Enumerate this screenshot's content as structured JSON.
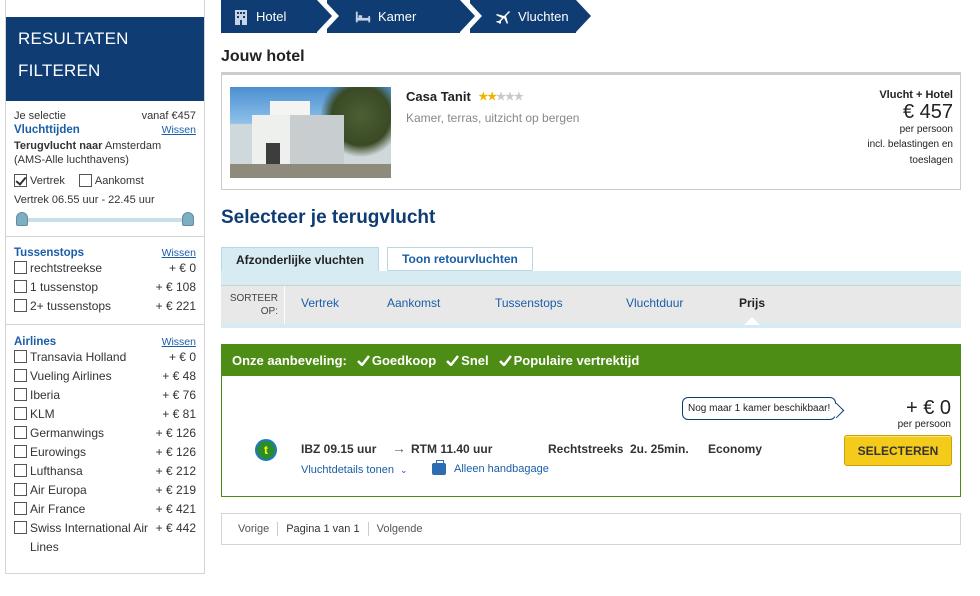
{
  "breadcrumb": {
    "items": [
      {
        "label": "Hotel",
        "icon": "building-icon"
      },
      {
        "label": "Kamer",
        "icon": "bed-icon"
      },
      {
        "label": "Vluchten",
        "icon": "plane-icon"
      }
    ]
  },
  "sidebar": {
    "header_line1": "RESULTATEN",
    "header_line2": "FILTEREN",
    "selection_label": "Je selectie",
    "selection_price": "vanaf €457",
    "flight_times": {
      "title": "Vluchttijden",
      "help": "Wissen",
      "return_prefix": "Terugvlucht naar",
      "return_city": "Amsterdam",
      "airports": "(AMS-Alle luchthavens)",
      "departure_label": "Vertrek",
      "arrival_label": "Aankomst",
      "range_text": "Vertrek 06.55 uur - 22.45 uur"
    },
    "stops": {
      "title": "Tussenstops",
      "help": "Wissen",
      "options": [
        {
          "label": "rechtstreekse",
          "price": "+ € 0"
        },
        {
          "label": "1 tussenstop",
          "price": "+ € 108"
        },
        {
          "label": "2+ tussenstops",
          "price": "+ € 221"
        }
      ]
    },
    "airlines": {
      "title": "Airlines",
      "help": "Wissen",
      "options": [
        {
          "label": "Transavia Holland",
          "price": "+ € 0"
        },
        {
          "label": "Vueling Airlines",
          "price": "+ € 48"
        },
        {
          "label": "Iberia",
          "price": "+ € 76"
        },
        {
          "label": "KLM",
          "price": "+ € 81"
        },
        {
          "label": "Germanwings",
          "price": "+ € 126"
        },
        {
          "label": "Eurowings",
          "price": "+ € 126"
        },
        {
          "label": "Lufthansa",
          "price": "+ € 212"
        },
        {
          "label": "Air Europa",
          "price": "+ € 219"
        },
        {
          "label": "Air France",
          "price": "+ € 421"
        },
        {
          "label": "Swiss International Air Lines",
          "price": "+ € 442"
        }
      ]
    }
  },
  "hotel": {
    "section_title": "Jouw hotel",
    "name": "Casa Tanit",
    "stars_on": "★★",
    "stars_off": "★★★",
    "rating": 2.5,
    "description": "Kamer, terras, uitzicht op bergen",
    "price_label": "Vlucht + Hotel",
    "price": "€ 457",
    "per_person": "per persoon",
    "note_line1": "incl. belastingen en",
    "note_line2": "toeslagen"
  },
  "flights": {
    "title": "Selecteer je terugvlucht",
    "tab_active": "Afzonderlijke vluchten",
    "tab_other": "Toon retourvluchten",
    "sort_label": "SORTEER OP:",
    "sort_options": [
      "Vertrek",
      "Aankomst",
      "Tussenstops",
      "Vluchtduur",
      "Prijs"
    ],
    "recommendation": {
      "heading": "Onze aanbeveling:",
      "tags": [
        "Goedkoop",
        "Snel",
        "Populaire vertrektijd"
      ],
      "tooltip": "Nog maar 1 kamer beschikbaar!",
      "price": "+ € 0",
      "per_person": "per persoon",
      "departure": "IBZ 09.15 uur",
      "arrival": "RTM 11.40 uur",
      "stops": "Rechtstreeks",
      "duration": "2u. 25min.",
      "cabin": "Economy",
      "details_link": "Vluchtdetails tonen",
      "baggage": "Alleen handbagage",
      "select_label": "SELECTEREN"
    }
  },
  "pager": {
    "prev": "Vorige",
    "current": "Pagina 1 van 1",
    "next": "Volgende"
  },
  "colors": {
    "brand_navy": "#0f3c73",
    "link_blue": "#1a5ea8",
    "reco_green": "#4e8d15",
    "button_yellow": "#f5cb1b"
  }
}
